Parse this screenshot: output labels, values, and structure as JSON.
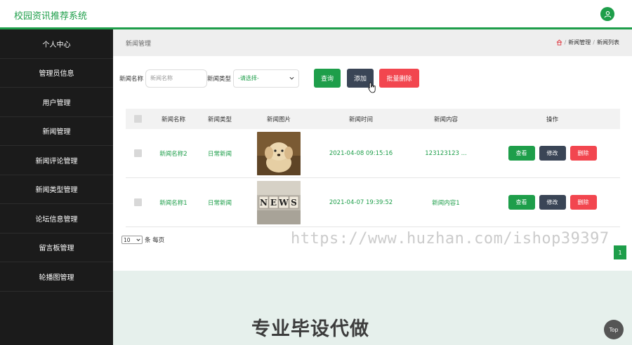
{
  "app": {
    "title": "校园资讯推荐系统"
  },
  "sidebar": {
    "items": [
      {
        "label": "个人中心"
      },
      {
        "label": "管理员信息"
      },
      {
        "label": "用户管理"
      },
      {
        "label": "新闻管理"
      },
      {
        "label": "新闻评论管理"
      },
      {
        "label": "新闻类型管理"
      },
      {
        "label": "论坛信息管理"
      },
      {
        "label": "留言板管理"
      },
      {
        "label": "轮播图管理"
      }
    ]
  },
  "breadcrumb": {
    "page_title": "新闻管理",
    "path": [
      "新闻管理",
      "新闻列表"
    ],
    "separator": "/",
    "home_icon": "home-icon"
  },
  "search": {
    "name_label": "新闻名称",
    "name_placeholder": "新闻名称",
    "type_label": "新闻类型",
    "type_selected": "-请选择-",
    "query_button": "查询",
    "add_button": "添加",
    "batch_delete_button": "批量删除"
  },
  "table": {
    "headers": [
      "新闻名称",
      "新闻类型",
      "新闻图片",
      "新闻时间",
      "新闻内容",
      "操作"
    ],
    "rows": [
      {
        "name": "新闻名称2",
        "type": "日常新闻",
        "image": "puppy-photo",
        "time": "2021-04-08 09:15:16",
        "content": "123123123 ..."
      },
      {
        "name": "新闻名称1",
        "type": "日常新闻",
        "image": "news-letters-photo",
        "time": "2021-04-07 19:39:52",
        "content": "新闻内容1"
      }
    ],
    "actions": {
      "view": "查看",
      "edit": "修改",
      "delete": "删除"
    }
  },
  "pager": {
    "page_size": "10",
    "page_size_suffix": "条 每页",
    "current_page": "1"
  },
  "overlay": {
    "watermark_url": "https://www.huzhan.com/ishop39397",
    "watermark_cn": "专业毕设代做",
    "top_button": "Top"
  },
  "colors": {
    "accent": "#1e9e4a",
    "danger": "#f2464f",
    "slate": "#3a4556",
    "sidebar": "#1b1b1b"
  }
}
